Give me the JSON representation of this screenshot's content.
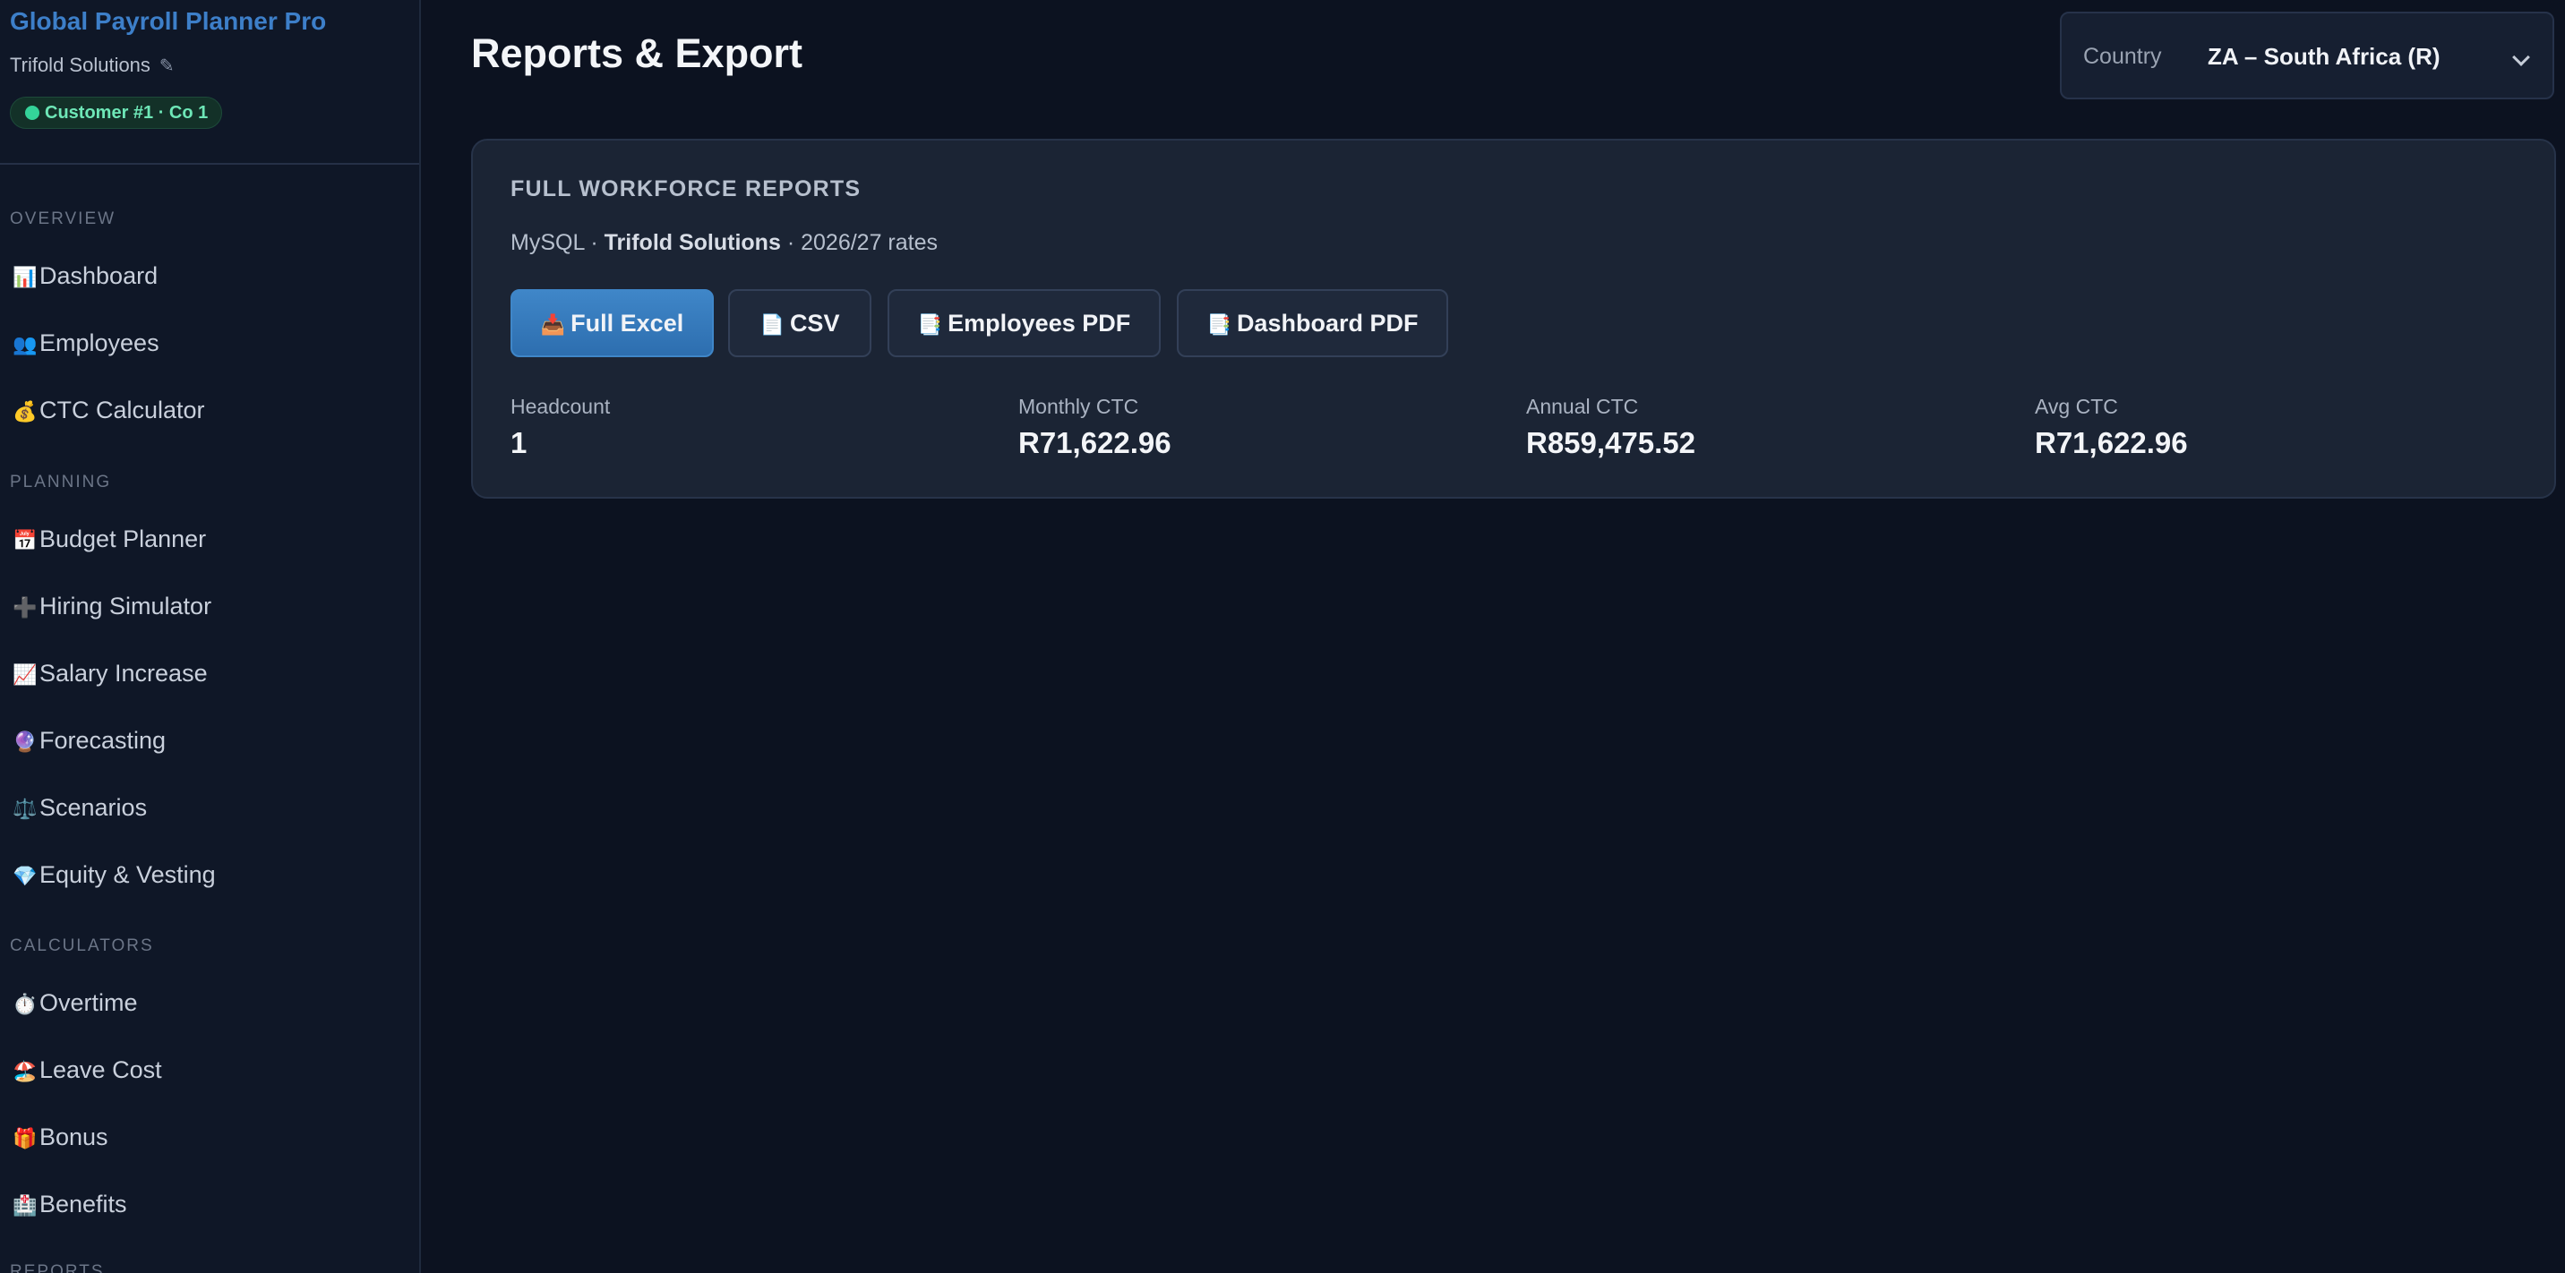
{
  "app": {
    "title": "Global Payroll Planner Pro",
    "company": "Trifold Solutions",
    "edit_glyph": "✎",
    "badge": "Customer #1 · Co 1"
  },
  "sidebar": {
    "sections": [
      {
        "label": "OVERVIEW",
        "items": [
          {
            "icon": "📊",
            "icon_name": "bar-chart-icon",
            "label": "Dashboard"
          },
          {
            "icon": "👥",
            "icon_name": "people-icon",
            "label": "Employees"
          },
          {
            "icon": "💰",
            "icon_name": "money-bag-icon",
            "label": "CTC Calculator"
          }
        ]
      },
      {
        "label": "PLANNING",
        "items": [
          {
            "icon": "📅",
            "icon_name": "calendar-icon",
            "label": "Budget Planner"
          },
          {
            "icon": "➕",
            "icon_name": "plus-icon",
            "label": "Hiring Simulator"
          },
          {
            "icon": "📈",
            "icon_name": "chart-increasing-icon",
            "label": "Salary Increase"
          },
          {
            "icon": "🔮",
            "icon_name": "crystal-ball-icon",
            "label": "Forecasting"
          },
          {
            "icon": "⚖️",
            "icon_name": "balance-scale-icon",
            "label": "Scenarios"
          },
          {
            "icon": "💎",
            "icon_name": "gem-icon",
            "label": "Equity & Vesting"
          }
        ]
      },
      {
        "label": "CALCULATORS",
        "items": [
          {
            "icon": "⏱️",
            "icon_name": "stopwatch-icon",
            "label": "Overtime"
          },
          {
            "icon": "🏖️",
            "icon_name": "beach-icon",
            "label": "Leave Cost"
          },
          {
            "icon": "🎁",
            "icon_name": "gift-icon",
            "label": "Bonus"
          },
          {
            "icon": "🏥",
            "icon_name": "hospital-icon",
            "label": "Benefits"
          }
        ]
      },
      {
        "label": "REPORTS",
        "items": []
      }
    ]
  },
  "header": {
    "title": "Reports & Export",
    "country_label": "Country",
    "country_value": "ZA – South Africa (R)"
  },
  "card": {
    "heading": "FULL WORKFORCE REPORTS",
    "sub_db": "MySQL",
    "sub_company": "Trifold Solutions",
    "sub_rates": "2026/27 rates",
    "sub_sep": "·",
    "buttons": [
      {
        "icon": "📥",
        "icon_name": "inbox-tray-icon",
        "label": "Full Excel"
      },
      {
        "icon": "📄",
        "icon_name": "document-icon",
        "label": "CSV"
      },
      {
        "icon": "📑",
        "icon_name": "bookmark-tabs-icon",
        "label": "Employees PDF"
      },
      {
        "icon": "📑",
        "icon_name": "bookmark-tabs-icon",
        "label": "Dashboard PDF"
      }
    ],
    "stats": [
      {
        "label": "Headcount",
        "value": "1"
      },
      {
        "label": "Monthly CTC",
        "value": "R71,622.96"
      },
      {
        "label": "Annual CTC",
        "value": "R859,475.52"
      },
      {
        "label": "Avg CTC",
        "value": "R71,622.96"
      }
    ]
  },
  "colors": {
    "background": "#0c1220",
    "sidebar": "#0f1727",
    "brand": "#3d7fc9",
    "accent_button": "#3f86c8",
    "badge_green": "#34d399",
    "card": "#1b2434"
  }
}
